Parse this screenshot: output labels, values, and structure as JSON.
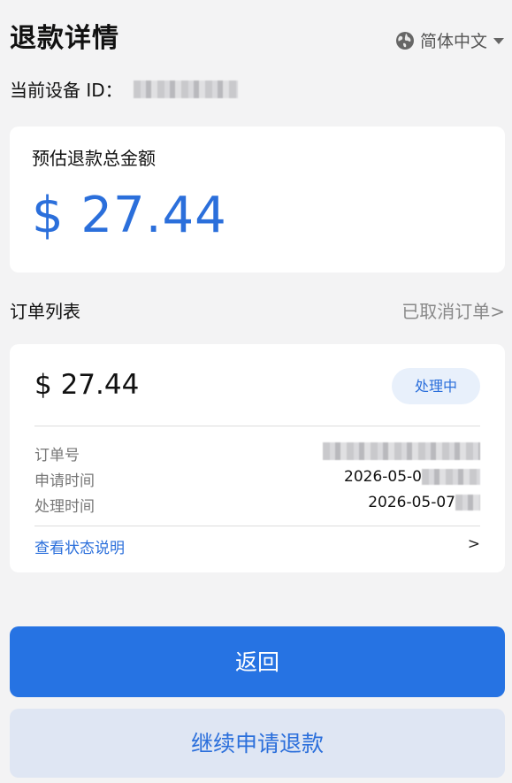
{
  "header": {
    "title": "退款详情",
    "language": "简体中文"
  },
  "device": {
    "label": "当前设备 ID："
  },
  "summary": {
    "label": "预估退款总金额",
    "amount": "$ 27.44"
  },
  "orders": {
    "title": "订单列表",
    "canceled_link": "已取消订单>",
    "items": [
      {
        "amount": "$ 27.44",
        "status": "处理中",
        "order_no_label": "订单号",
        "apply_time_label": "申请时间",
        "apply_time_value": "2026-05-0",
        "process_time_label": "处理时间",
        "process_time_value": "2026-05-07",
        "status_explain_label": "查看状态说明",
        "status_explain_arrow": ">"
      }
    ]
  },
  "buttons": {
    "back": "返回",
    "continue": "继续申请退款"
  },
  "colors": {
    "accent": "#2b6fdb",
    "primary_button": "#2673e3",
    "secondary_button": "#dfe6f3",
    "badge_bg": "#e8f0fb",
    "background": "#f3f3f4"
  },
  "icons": {
    "language": "globe-icon",
    "dropdown": "caret-down-icon"
  }
}
